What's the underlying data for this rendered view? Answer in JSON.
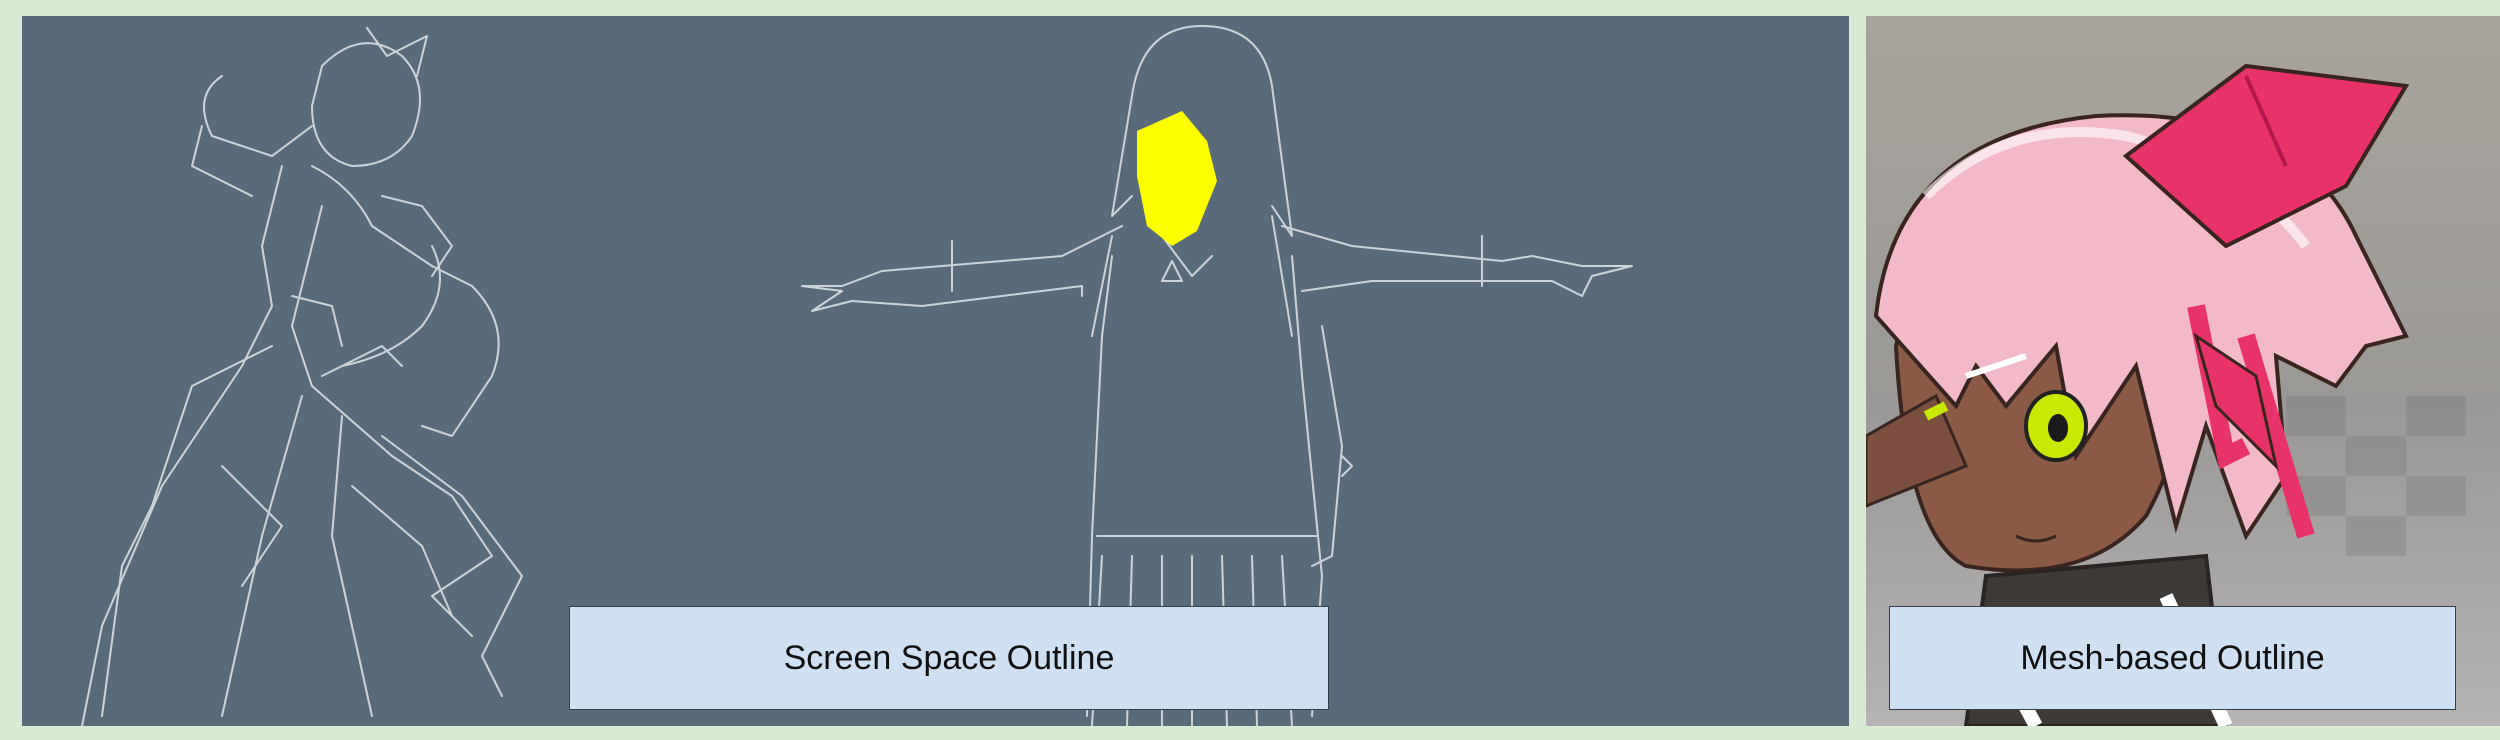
{
  "panels": {
    "left": {
      "caption": "Screen Space Outline",
      "background": "#596b7a",
      "outline_color": "#e6ecf0",
      "highlight_color": "#ffff00"
    },
    "right": {
      "caption": "Mesh-based Outline",
      "hair_color": "#f2b9c9",
      "ribbon_color": "#e8336a",
      "skin_color": "#8a5a45",
      "eye_color": "#c9e800"
    }
  },
  "page": {
    "background": "#d9ead3"
  }
}
